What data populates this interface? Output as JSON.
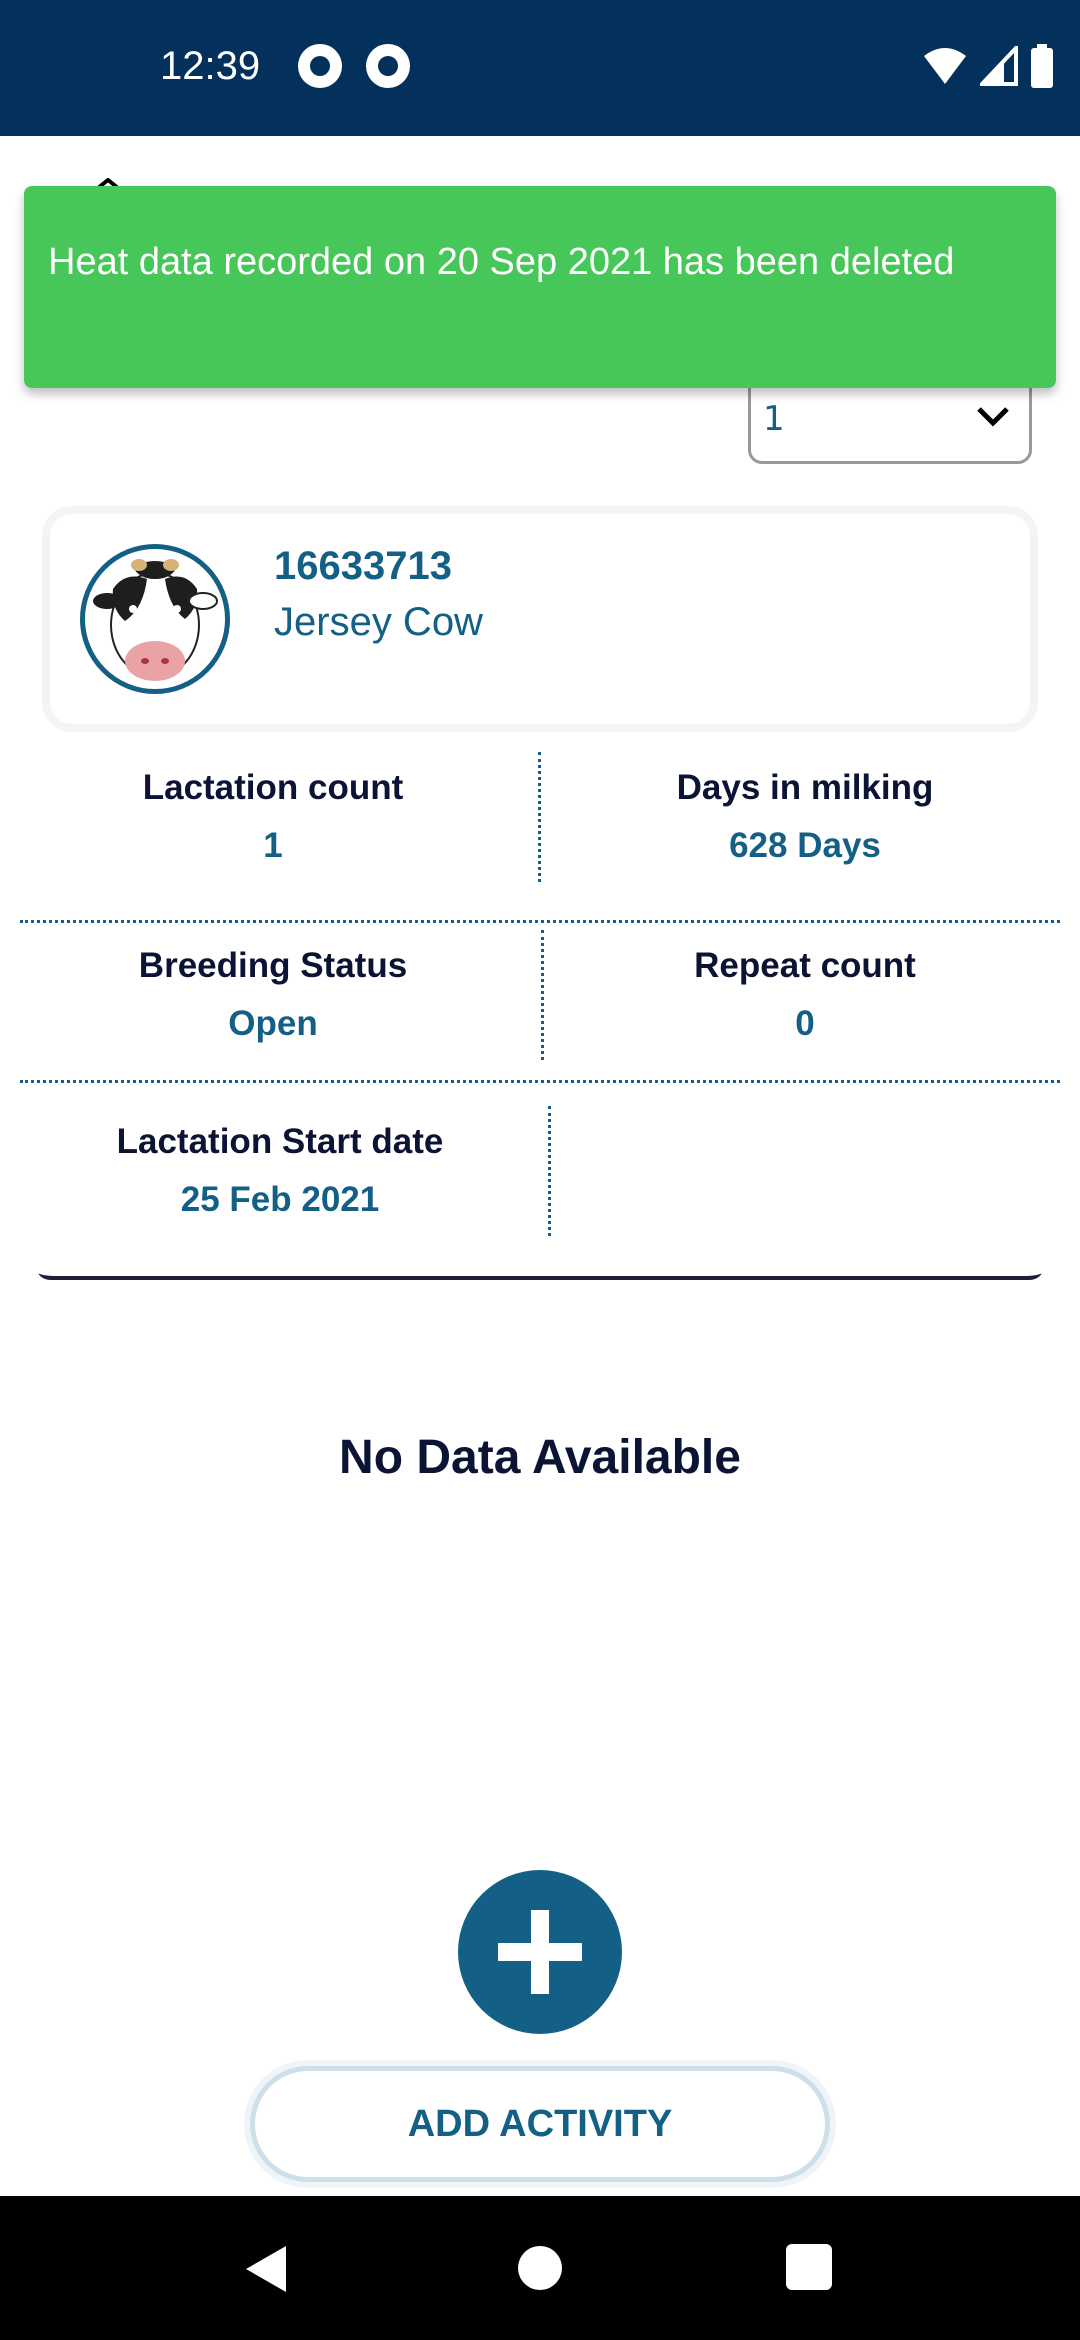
{
  "status_bar": {
    "time": "12:39",
    "icons": [
      "sync-icon",
      "app-icon",
      "wifi-icon",
      "cellular-icon",
      "battery-icon"
    ]
  },
  "lactation_select": {
    "value": "1"
  },
  "cow": {
    "id": "16633713",
    "name": "Jersey  Cow"
  },
  "stats": {
    "lactation_count": {
      "label": "Lactation count",
      "value": "1"
    },
    "days_in_milking": {
      "label": "Days in milking",
      "value": "628 Days"
    },
    "breeding_status": {
      "label": "Breeding Status",
      "value": "Open"
    },
    "repeat_count": {
      "label": "Repeat count",
      "value": "0"
    },
    "lactation_start": {
      "label": "Lactation Start date",
      "value": "25 Feb 2021"
    }
  },
  "toast": {
    "message": "Heat data recorded on 20 Sep 2021 has been deleted"
  },
  "empty_state": {
    "text": "No Data Available"
  },
  "actions": {
    "add_activity_label": "ADD ACTIVITY"
  },
  "colors": {
    "status_bar": "#04305c",
    "primary": "#135f85",
    "toast": "#47c759",
    "text_dark": "#0c1435"
  }
}
